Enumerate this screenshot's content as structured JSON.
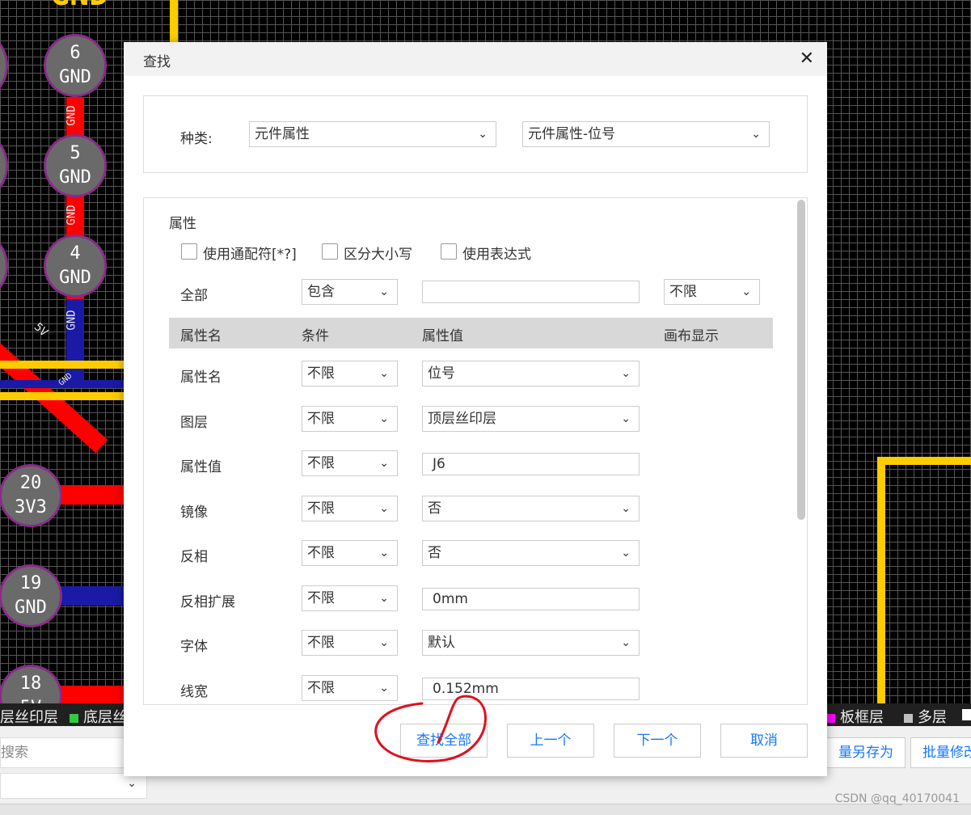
{
  "canvas": {
    "top_label": "GND",
    "pads": [
      {
        "num": "6",
        "net": "GND"
      },
      {
        "num": "5",
        "net": "GND"
      },
      {
        "num": "4",
        "net": "GND"
      },
      {
        "num": "20",
        "net": "3V3"
      },
      {
        "num": "19",
        "net": "GND"
      },
      {
        "num": "18",
        "net": "5V"
      }
    ],
    "trace_labels": [
      "GND",
      "GND",
      "GND",
      "5V",
      "GND"
    ]
  },
  "layer_bar": {
    "left": [
      {
        "label": "层丝印层",
        "color": ""
      },
      {
        "label": "底层丝",
        "color": "#2ecc40"
      }
    ],
    "right": [
      {
        "label": "板框层",
        "color": "#ff00ff"
      },
      {
        "label": "多层",
        "color": "#c0c0c0"
      }
    ]
  },
  "bottom_panel": {
    "search_placeholder": "搜索",
    "buttons": [
      "量另存为",
      "批量修改"
    ],
    "watermark": "CSDN @qq_40170041"
  },
  "dialog": {
    "title": "查找",
    "kind_label": "种类:",
    "kind_value": "元件属性",
    "kind_sub_value": "元件属性-位号",
    "section_title": "属性",
    "options": [
      "使用通配符[*?]",
      "区分大小写",
      "使用表达式"
    ],
    "all_row": {
      "label": "全部",
      "condition": "包含",
      "value": "",
      "canvas": "不限"
    },
    "headers": [
      "属性名",
      "条件",
      "属性值",
      "画布显示"
    ],
    "rows": [
      {
        "name": "属性名",
        "condition": "不限",
        "value": "位号",
        "value_type": "select"
      },
      {
        "name": "图层",
        "condition": "不限",
        "value": "顶层丝印层",
        "value_type": "select"
      },
      {
        "name": "属性值",
        "condition": "不限",
        "value": "J6",
        "value_type": "text"
      },
      {
        "name": "镜像",
        "condition": "不限",
        "value": "否",
        "value_type": "select"
      },
      {
        "name": "反相",
        "condition": "不限",
        "value": "否",
        "value_type": "select"
      },
      {
        "name": "反相扩展",
        "condition": "不限",
        "value": "0mm",
        "value_type": "text"
      },
      {
        "name": "字体",
        "condition": "不限",
        "value": "默认",
        "value_type": "select"
      },
      {
        "name": "线宽",
        "condition": "不限",
        "value": "0.152mm",
        "value_type": "text"
      }
    ],
    "footer_buttons": [
      "查找全部",
      "上一个",
      "下一个",
      "取消"
    ]
  },
  "colors": {
    "accent": "#1677ff",
    "trace_red": "#ff0000",
    "trace_yellow": "#ffcc00",
    "trace_blue": "#1a1aa6",
    "annotation": "#e0101e"
  }
}
